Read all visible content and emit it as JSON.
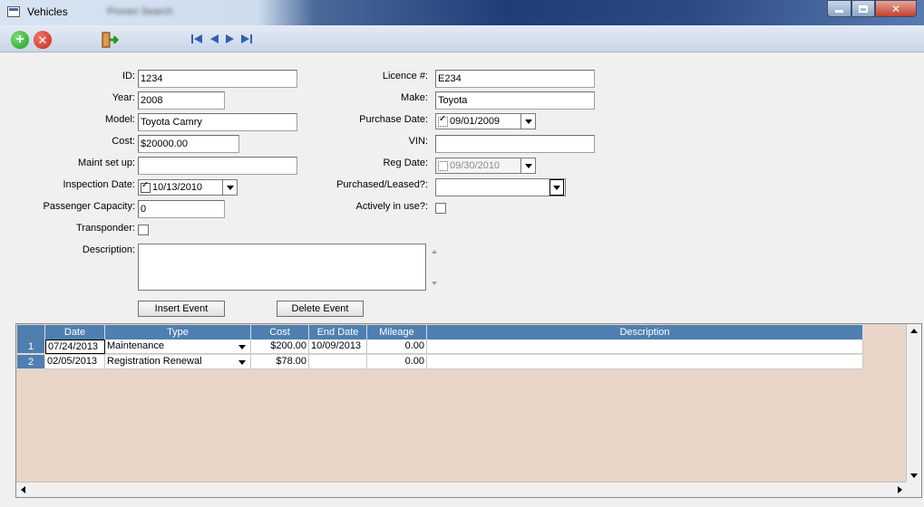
{
  "window": {
    "title": "Vehicles",
    "subtitle_blurred": "Proven Search"
  },
  "form": {
    "id_label": "ID:",
    "id_value": "1234",
    "year_label": "Year:",
    "year_value": "2008",
    "model_label": "Model:",
    "model_value": "Toyota Camry",
    "cost_label": "Cost:",
    "cost_value": "$20000.00",
    "maint_label": "Maint set up:",
    "maint_value": "",
    "inspection_label": "Inspection Date:",
    "inspection_value": "10/13/2010",
    "passenger_label": "Passenger Capacity:",
    "passenger_value": "0",
    "transponder_label": "Transponder:",
    "description_label": "Description:",
    "description_value": "",
    "licence_label": "Licence #:",
    "licence_value": "E234",
    "make_label": "Make:",
    "make_value": "Toyota",
    "purchase_date_label": "Purchase Date:",
    "purchase_date_value": "09/01/2009",
    "vin_label": "VIN:",
    "vin_value": "",
    "reg_date_label": "Reg Date:",
    "reg_date_value": "09/30/2010",
    "purchased_leased_label": "Purchased/Leased?:",
    "purchased_leased_value": "",
    "actively_label": "Actively in use?:",
    "insert_event_label": "Insert Event",
    "delete_event_label": "Delete Event"
  },
  "grid": {
    "headers": [
      "Date",
      "Type",
      "Cost",
      "End Date",
      "Mileage",
      "Description"
    ],
    "rows": [
      {
        "num": "1",
        "date": "07/24/2013",
        "type": "Maintenance",
        "cost": "$200.00",
        "end_date": "10/09/2013",
        "mileage": "0.00",
        "description": ""
      },
      {
        "num": "2",
        "date": "02/05/2013",
        "type": "Registration Renewal",
        "cost": "$78.00",
        "end_date": "",
        "mileage": "0.00",
        "description": ""
      }
    ]
  },
  "colors": {
    "grid_header": "#4f7fb0",
    "grid_background": "#e8d5c8",
    "add_button": "#1e9b1e",
    "delete_button": "#c4261a",
    "exit_icon": "#c07a30"
  },
  "icons": [
    "app-window-icon",
    "add-icon",
    "delete-icon",
    "exit-door-icon",
    "first-record-icon",
    "previous-record-icon",
    "next-record-icon",
    "last-record-icon"
  ]
}
